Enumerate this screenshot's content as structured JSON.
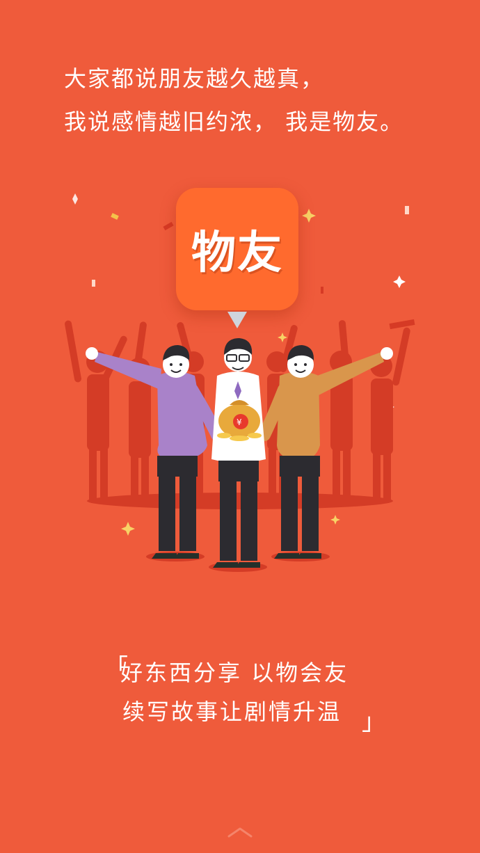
{
  "intro": {
    "line1": "大家都说朋友越久越真，",
    "line2": "我说感情越旧约浓， 我是物友。"
  },
  "app_badge": {
    "label": "物友"
  },
  "slogan": {
    "open_bracket": "「",
    "line1": "好东西分享  以物会友",
    "line2": "续写故事让剧情升温",
    "close_bracket": "」"
  },
  "colors": {
    "background": "#ef5b3b",
    "badge": "#ff6a2e",
    "text": "#ffffff"
  },
  "icons": {
    "bottom": "chevron-up-icon"
  }
}
